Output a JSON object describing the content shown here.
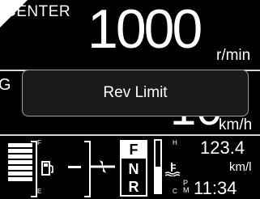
{
  "header": {
    "center_label": "CENTER"
  },
  "tach": {
    "rpm": "1000",
    "unit": "r/min"
  },
  "speed": {
    "value": "10",
    "unit": "km/h",
    "gear_letter": "G"
  },
  "overlay": {
    "message": "Rev Limit"
  },
  "fuel": {
    "full_label": "F",
    "empty_label": "E",
    "level_bars": 7,
    "icon": "fuel-pump-icon"
  },
  "transmission": {
    "gears": [
      "F",
      "N",
      "R"
    ],
    "selected": "F"
  },
  "temperature": {
    "hot_label": "H",
    "cold_label": "C",
    "icon": "coolant-temp-icon",
    "level": 0.5
  },
  "trip": {
    "value": "123.4",
    "unit": "km/l"
  },
  "clock": {
    "ampm_top": "P",
    "ampm_bottom": "M",
    "time": "11:34"
  }
}
